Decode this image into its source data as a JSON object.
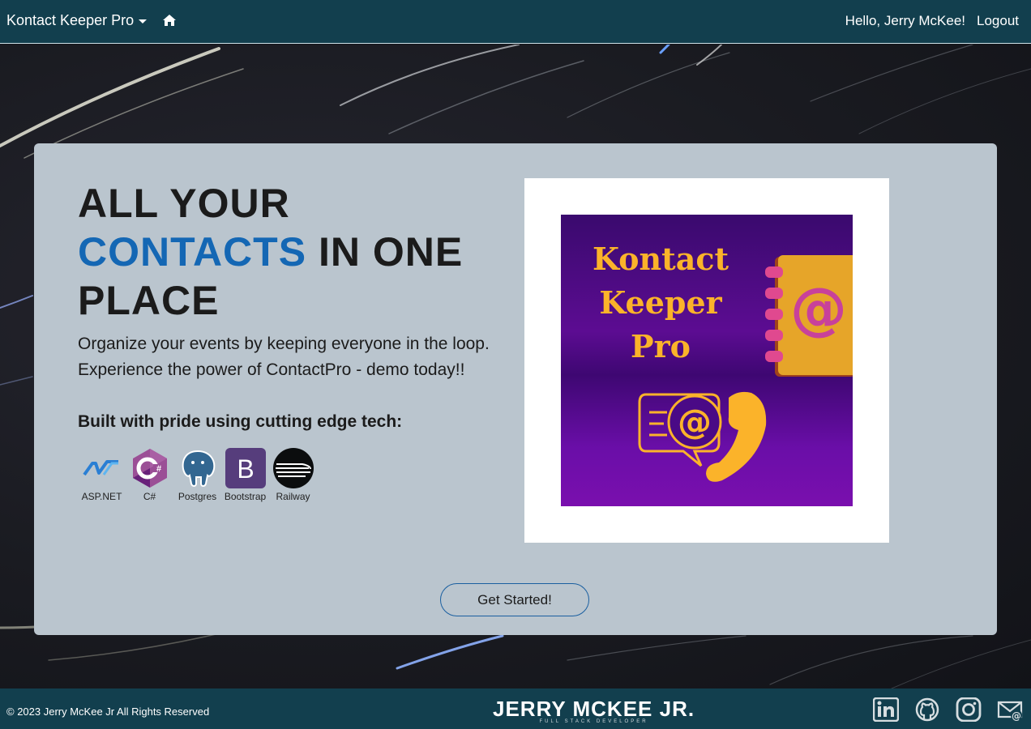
{
  "navbar": {
    "brand": "Kontact Keeper Pro",
    "greeting": "Hello, Jerry McKee!",
    "logout": "Logout"
  },
  "hero": {
    "headline_line1": "ALL YOUR",
    "headline_accent": "CONTACTS",
    "headline_rest": " IN ONE",
    "headline_line3": "PLACE",
    "lead_line1": "Organize your events by keeping everyone in the loop.",
    "lead_line2": "Experience the power of ContactPro - demo today!!",
    "tech_title": "Built with pride using cutting edge tech:",
    "tech": [
      {
        "label": "ASP.NET",
        "icon": "aspnet-icon"
      },
      {
        "label": "C#",
        "icon": "csharp-icon"
      },
      {
        "label": "Postgres",
        "icon": "postgres-icon"
      },
      {
        "label": "Bootstrap",
        "icon": "bootstrap-icon"
      },
      {
        "label": "Railway",
        "icon": "railway-icon"
      }
    ],
    "promo_title_1": "Kontact",
    "promo_title_2": "Keeper",
    "promo_title_3": "Pro",
    "cta": "Get Started!"
  },
  "footer": {
    "copyright": "© 2023 Jerry McKee Jr All Rights Reserved",
    "logo_name": "JERRY MCKEE JR.",
    "logo_sub": "FULL STACK DEVELOPER",
    "social": [
      "linkedin-icon",
      "github-icon",
      "instagram-icon",
      "email-icon"
    ]
  },
  "colors": {
    "nav_bg": "#123f4e",
    "card_bg": "#bac5ce",
    "accent": "#1467b4",
    "promo_gold": "#fbb32a",
    "promo_purple": "#5c0c92"
  }
}
